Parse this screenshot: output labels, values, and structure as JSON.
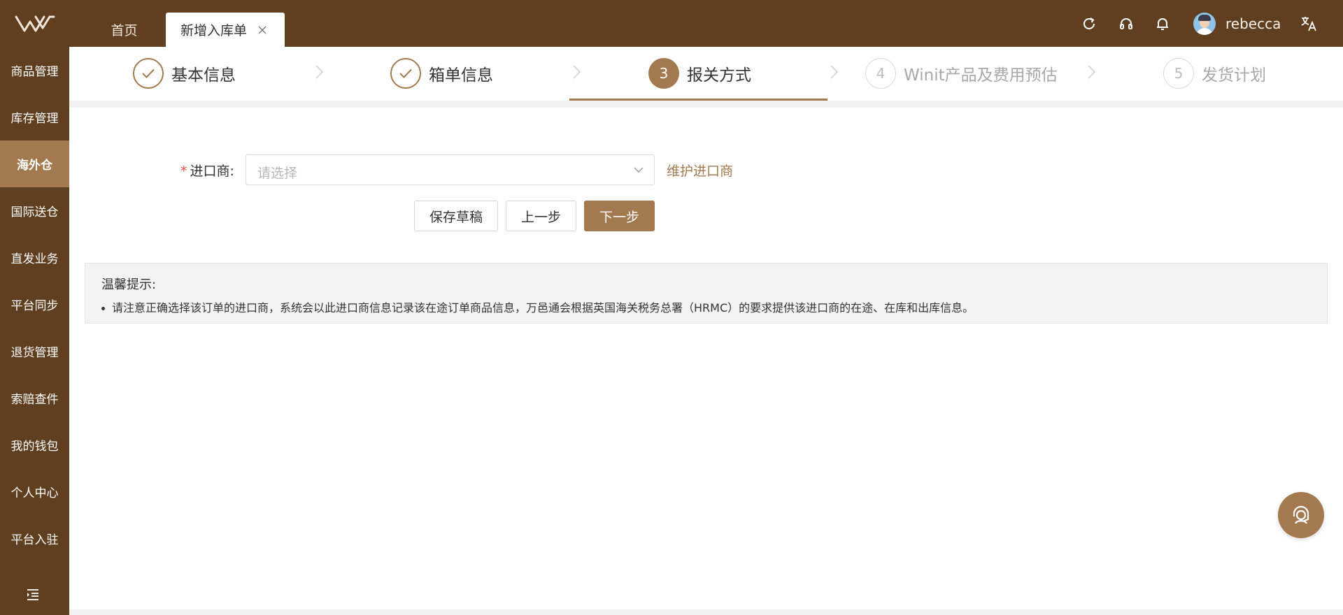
{
  "brand": {
    "accent": "#a37a4f",
    "header_bg": "#5f3f1f",
    "logo": "W"
  },
  "tabs": {
    "home": "首页",
    "active": "新增入库单"
  },
  "user": {
    "name": "rebecca"
  },
  "toolbar": {
    "icons": [
      "refresh-icon",
      "headset-icon",
      "bell-icon",
      "translate-icon"
    ]
  },
  "sidebar": {
    "items": [
      {
        "label": "商品管理"
      },
      {
        "label": "库存管理"
      },
      {
        "label": "海外仓"
      },
      {
        "label": "国际送仓"
      },
      {
        "label": "直发业务"
      },
      {
        "label": "平台同步"
      },
      {
        "label": "退货管理"
      },
      {
        "label": "索赔查件"
      },
      {
        "label": "我的钱包"
      },
      {
        "label": "个人中心"
      },
      {
        "label": "平台入驻"
      }
    ],
    "active_index": 2
  },
  "steps": [
    {
      "label": "基本信息",
      "status": "done"
    },
    {
      "label": "箱单信息",
      "status": "done"
    },
    {
      "number": "3",
      "label": "报关方式",
      "status": "current"
    },
    {
      "number": "4",
      "label": "Winit产品及费用预估",
      "status": "todo"
    },
    {
      "number": "5",
      "label": "发货计划",
      "status": "todo"
    }
  ],
  "form": {
    "importer": {
      "required_mark": "*",
      "label": "进口商:",
      "placeholder": "请选择",
      "value": "",
      "maintain_link": "维护进口商"
    }
  },
  "actions": {
    "save_draft": "保存草稿",
    "prev": "上一步",
    "next": "下一步"
  },
  "tip": {
    "title": "温馨提示:",
    "text": "请注意正确选择该订单的进口商，系统会以此进口商信息记录该在途订单商品信息，万邑通会根据英国海关税务总署（HRMC）的要求提供该进口商的在途、在库和出库信息。"
  }
}
